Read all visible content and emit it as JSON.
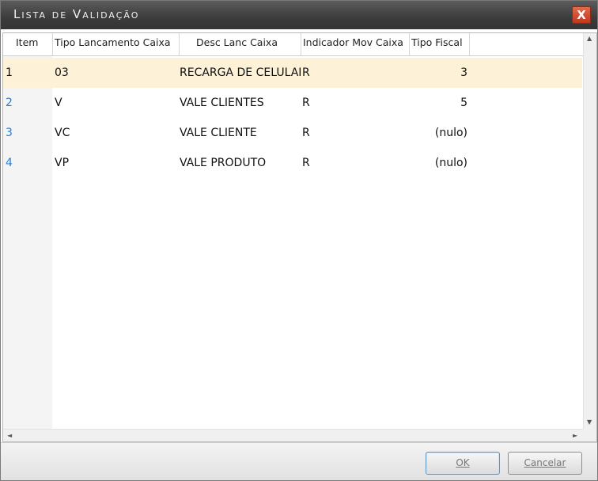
{
  "window": {
    "title": "Lista de Validação",
    "close_label": "X"
  },
  "grid": {
    "columns": [
      "Item",
      "Tipo Lancamento Caixa",
      "Desc Lanc Caixa",
      "Indicador Mov Caixa",
      "Tipo Fiscal"
    ],
    "rows": [
      {
        "item": "1",
        "tipo": "03",
        "desc": "RECARGA DE CELULAR",
        "indicador": "R",
        "fiscal": "3"
      },
      {
        "item": "2",
        "tipo": "V",
        "desc": "VALE CLIENTES",
        "indicador": "R",
        "fiscal": "5"
      },
      {
        "item": "3",
        "tipo": "VC",
        "desc": "VALE CLIENTE",
        "indicador": "R",
        "fiscal": "(nulo)"
      },
      {
        "item": "4",
        "tipo": "VP",
        "desc": "VALE PRODUTO",
        "indicador": "R",
        "fiscal": "(nulo)"
      }
    ],
    "selected_row_index": 0
  },
  "scrollbars": {
    "up_arrow": "▲",
    "down_arrow": "▼",
    "left_arrow": "◄",
    "right_arrow": "►"
  },
  "footer": {
    "ok_label": "OK",
    "cancel_label": "Cancelar"
  },
  "colors": {
    "selected_row": "#fdf2d8",
    "item_link": "#2a7ed8",
    "title_bar": "#3c3c3c",
    "close_button": "#d04a2c"
  }
}
